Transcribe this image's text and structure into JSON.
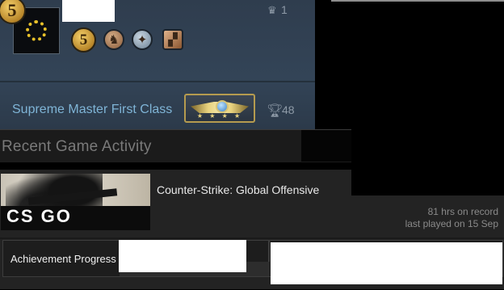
{
  "profile_card": {
    "level": "5",
    "crown_count": "1",
    "rank_name": "Supreme Master First Class",
    "trophy_count": "48",
    "badges": [
      "level-5-coin",
      "chess-knight-badge",
      "soldier-medal-badge",
      "map-badge"
    ]
  },
  "activity": {
    "title": "Recent Game Activity",
    "game": {
      "name": "Counter-Strike: Global Offensive",
      "capsule_logo": "CS GO",
      "hours": "81 hrs on record",
      "last_played": "last played on 15 Sep"
    },
    "achievement_label": "Achievement Progress"
  },
  "colors": {
    "card_bg": "#334457",
    "rank_text": "#7fb4d6",
    "panel_bg": "#232323",
    "accent_gold": "#e8c12a"
  }
}
